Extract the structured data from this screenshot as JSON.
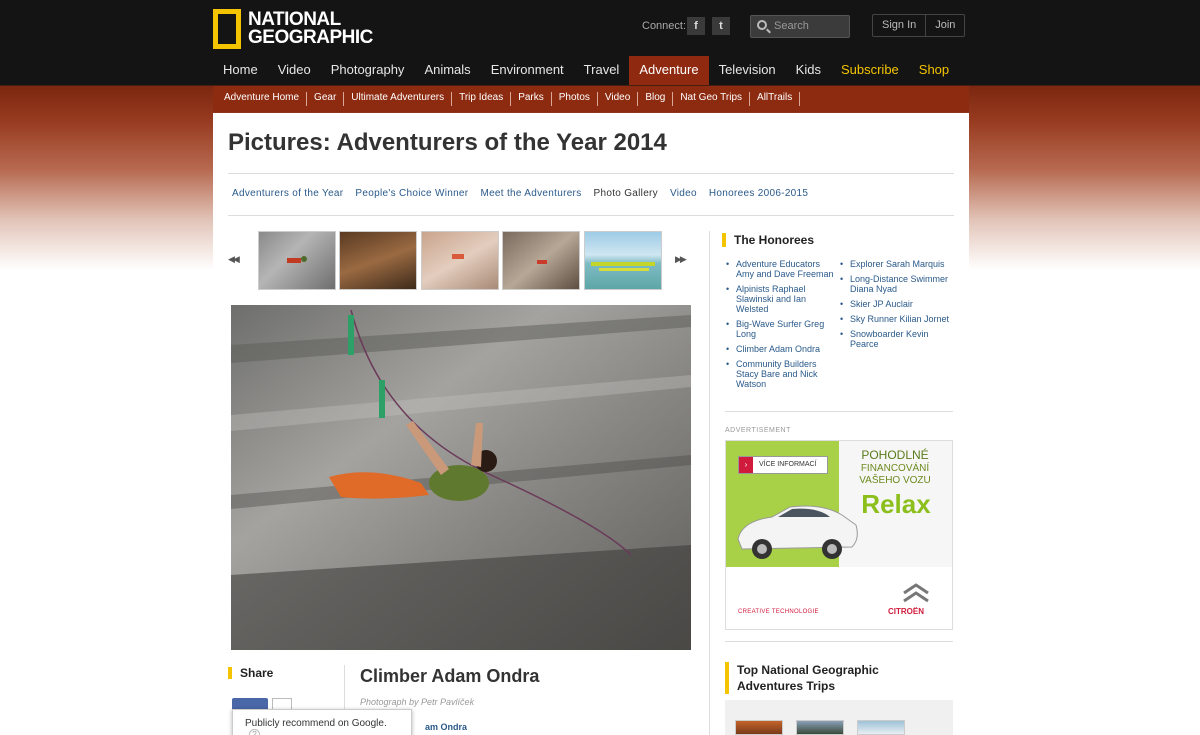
{
  "header": {
    "brand": "NATIONAL GEOGRAPHIC",
    "brand_line1": "NATIONAL",
    "brand_line2": "GEOGRAPHIC",
    "connect_label": "Connect:",
    "social": [
      "f",
      "t"
    ],
    "search_placeholder": "Search",
    "sign_in": "Sign In",
    "join": "Join",
    "accent_color": "#f5c400"
  },
  "main_nav": [
    {
      "label": "Home"
    },
    {
      "label": "Video"
    },
    {
      "label": "Photography"
    },
    {
      "label": "Animals"
    },
    {
      "label": "Environment"
    },
    {
      "label": "Travel"
    },
    {
      "label": "Adventure",
      "active": true
    },
    {
      "label": "Television"
    },
    {
      "label": "Kids"
    },
    {
      "label": "Subscribe",
      "highlight": true
    },
    {
      "label": "Shop",
      "highlight": true
    }
  ],
  "sub_nav": [
    "Adventure Home",
    "Gear",
    "Ultimate Adventurers",
    "Trip Ideas",
    "Parks",
    "Photos",
    "Video",
    "Blog",
    "Nat Geo Trips",
    "AllTrails"
  ],
  "page": {
    "title": "Pictures: Adventurers of the Year 2014",
    "section_tabs": [
      {
        "label": "Adventurers of the Year"
      },
      {
        "label": "People's Choice Winner"
      },
      {
        "label": "Meet the Adventurers"
      },
      {
        "label": "Photo Gallery",
        "current": true
      },
      {
        "label": "Video"
      },
      {
        "label": "Honorees 2006-2015"
      }
    ],
    "thumbnail_prev": "◀◀",
    "thumbnail_next": "▶▶",
    "thumbnail_count": 5,
    "share_heading": "Share",
    "photo_caption": "Climber Adam Ondra",
    "photo_credit": "Photograph by Petr Pavlíček",
    "google_tooltip": "Publicly recommend on Google.",
    "google_help": "?",
    "related_link": "am Ondra"
  },
  "sidebar": {
    "honorees_heading": "The Honorees",
    "honorees_col1": [
      "Adventure Educators Amy and Dave Freeman",
      "Alpinists Raphael Slawinski and Ian Welsted",
      "Big-Wave Surfer Greg Long",
      "Climber Adam Ondra",
      "Community Builders Stacy Bare and Nick Watson"
    ],
    "honorees_col2": [
      "Explorer Sarah Marquis",
      "Long-Distance Swimmer Diana Nyad",
      "Skier JP Auclair",
      "Sky Runner Kilian Jornet",
      "Snowboarder Kevin Pearce"
    ],
    "ad_label": "ADVERTISEMENT",
    "ad": {
      "button": "VÍCE INFORMACÍ",
      "line1": "POHODLNÉ",
      "line2": "FINANCOVÁNÍ",
      "line3": "VAŠEHO VOZU",
      "slogan": "Relax",
      "tagline": "CREATIVE TECHNOLOGIE",
      "brand": "CITROËN"
    },
    "trips_heading": "Top National Geographic Adventures Trips"
  }
}
